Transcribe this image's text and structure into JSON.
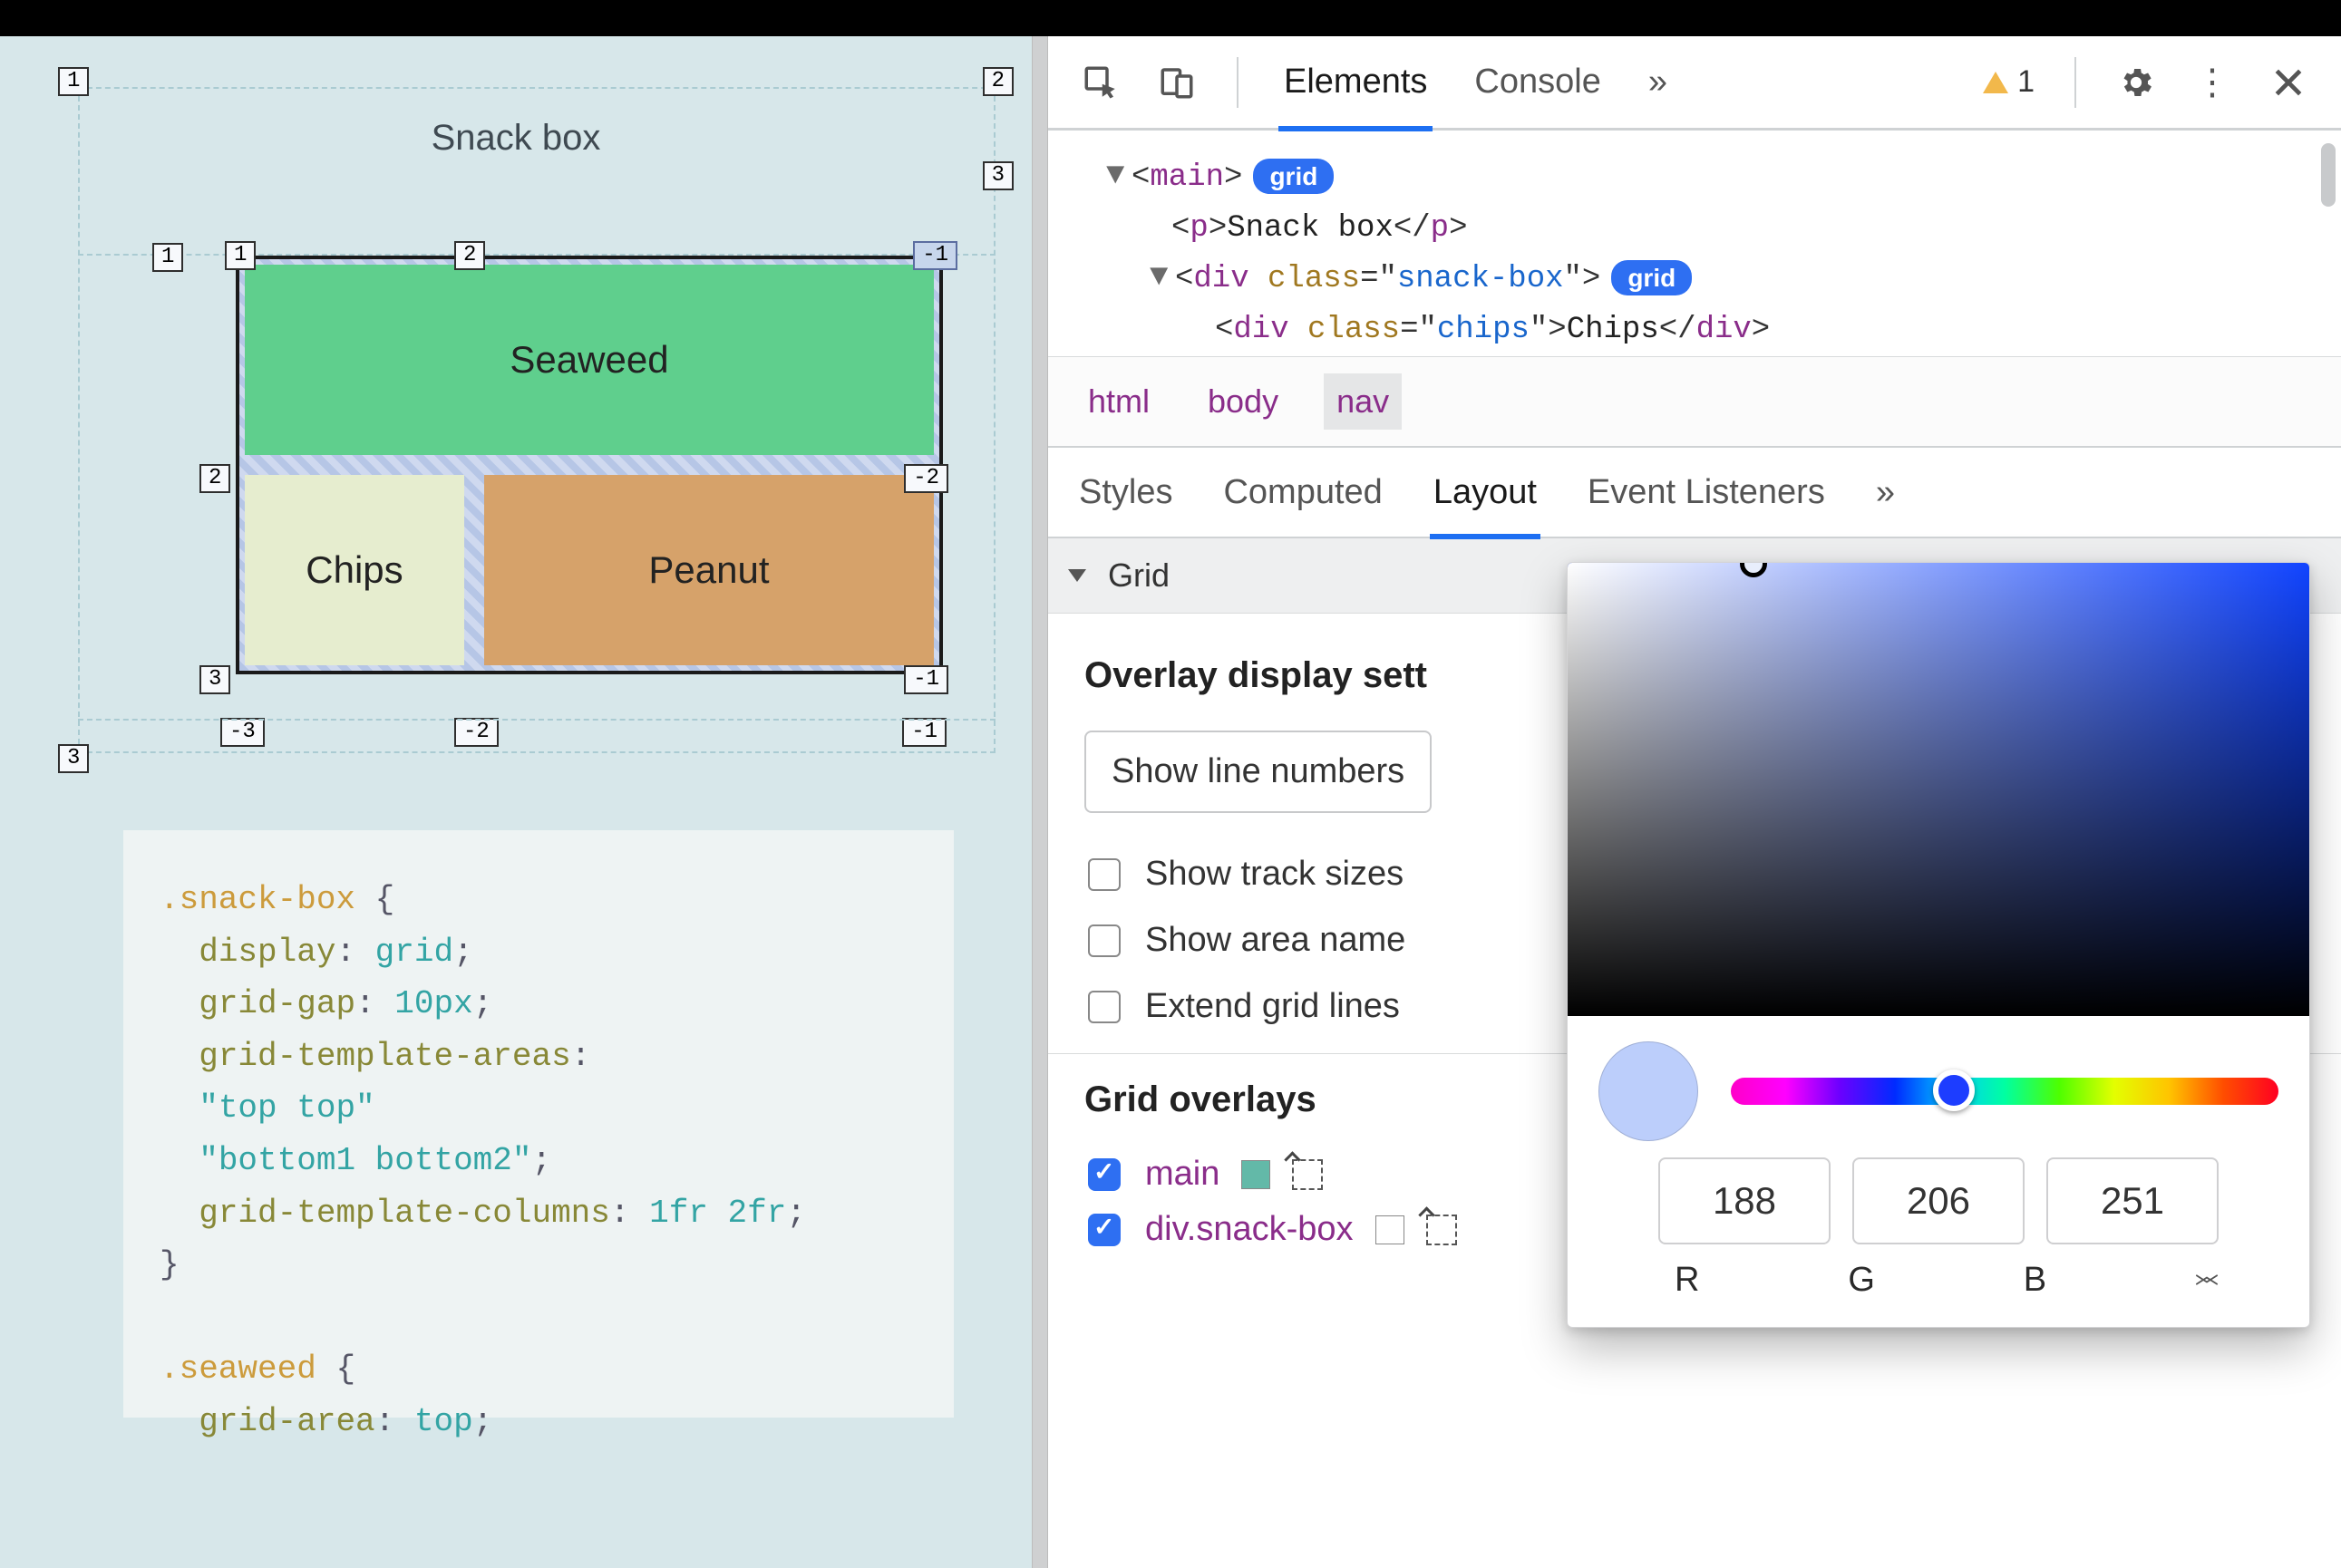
{
  "page": {
    "title": "Snack box",
    "grid_items": {
      "seaweed": "Seaweed",
      "chips": "Chips",
      "peanut": "Peanut"
    },
    "line_chips": {
      "col": [
        "1",
        "2",
        "3",
        "-1",
        "-2",
        "-3"
      ],
      "row": [
        "1",
        "2",
        "3",
        "-1",
        "-2"
      ]
    },
    "css": ".snack-box {\n  display: grid;\n  grid-gap: 10px;\n  grid-template-areas:\n  \"top top\"\n  \"bottom1 bottom2\";\n  grid-template-columns: 1fr 2fr;\n}\n\n.seaweed {\n  grid-area: top;\n}"
  },
  "devtools": {
    "tabs": {
      "elements": "Elements",
      "console": "Console",
      "more": "»"
    },
    "warnings": "1",
    "dom": {
      "l1_tag": "main",
      "l1_pill": "grid",
      "l2_tag": "p",
      "l2_text": "Snack box",
      "l3_tag": "div",
      "l3_attr": "class",
      "l3_val": "snack-box",
      "l3_pill": "grid",
      "l4_tag": "div",
      "l4_attr": "class",
      "l4_val": "chips",
      "l4_text": "Chips"
    },
    "crumbs": [
      "html",
      "body",
      "nav"
    ],
    "subtabs": {
      "styles": "Styles",
      "computed": "Computed",
      "layout": "Layout",
      "events": "Event Listeners",
      "more": "»"
    },
    "grid_section": "Grid",
    "overlay_heading": "Overlay display sett",
    "select_label": "Show line numbers",
    "opt_track": "Show track sizes",
    "opt_area": "Show area name",
    "opt_extend": "Extend grid lines",
    "overlays_heading": "Grid overlays",
    "overlays": [
      {
        "name": "main",
        "swatch": "#63b9a8"
      },
      {
        "name": "div.snack-box",
        "swatch": "#ffffff"
      }
    ]
  },
  "picker": {
    "r": "188",
    "g": "206",
    "b": "251",
    "lr": "R",
    "lg": "G",
    "lb": "B"
  }
}
